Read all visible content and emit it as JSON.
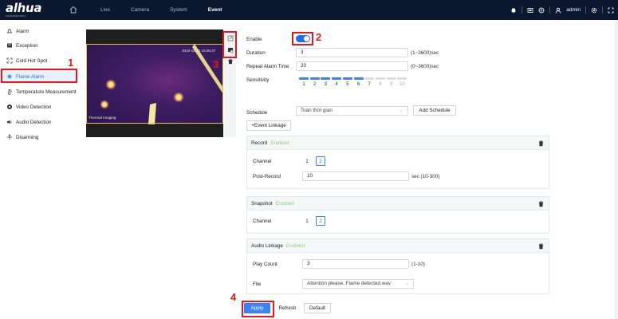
{
  "brand": {
    "logo": "alhua",
    "subtext": "TECHNOLOGY"
  },
  "nav": [
    {
      "label": "Live"
    },
    {
      "label": "Camera"
    },
    {
      "label": "System"
    },
    {
      "label": "Event",
      "active": true
    }
  ],
  "topright": {
    "user": "admin"
  },
  "sidebar": {
    "items": [
      {
        "label": "Alarm",
        "icon": "alarm-icon"
      },
      {
        "label": "Exception",
        "icon": "exception-icon"
      },
      {
        "label": "Cold Hot Spot",
        "icon": "cold-hot-spot-icon"
      },
      {
        "label": "Flame Alarm",
        "icon": "flame-icon",
        "active": true
      },
      {
        "label": "Temperature Measurement",
        "icon": "thermometer-icon"
      },
      {
        "label": "Video Detection",
        "icon": "video-detection-icon"
      },
      {
        "label": "Audio Detection",
        "icon": "audio-icon"
      },
      {
        "label": "Disarming",
        "icon": "disarming-icon"
      }
    ]
  },
  "video": {
    "timestamp": "2023-11-30 15:05:27",
    "label": "Thermal Imaging"
  },
  "form": {
    "enable_label": "Enable",
    "duration_label": "Duration",
    "duration_value": "3",
    "duration_hint": "(1~3600)sec",
    "repeat_label": "Repeat Alarm Time",
    "repeat_value": "20",
    "repeat_hint": "(0~3600)sec",
    "sensitivity_label": "Sensitivity",
    "sensitivity_level": 6,
    "sensitivity_ticks": [
      "1",
      "2",
      "3",
      "4",
      "5",
      "6",
      "7",
      "8",
      "9",
      "10"
    ],
    "schedule_label": "Schedule",
    "schedule_value": "Toàn thời gian",
    "add_schedule": "Add Schedule",
    "event_linkage": "+Event Linkage"
  },
  "record": {
    "title": "Record",
    "status": "Enabled",
    "channel_label": "Channel",
    "channels": [
      "1",
      "2"
    ],
    "post_label": "Post-Record",
    "post_value": "10",
    "post_hint": "sec (10-300)"
  },
  "snapshot": {
    "title": "Snapshot",
    "status": "Enabled",
    "channel_label": "Channel",
    "channels": [
      "1",
      "2"
    ]
  },
  "audio": {
    "title": "Audio Linkage",
    "status": "Enabled",
    "play_label": "Play Count",
    "play_value": "3",
    "play_hint": "(1-10)",
    "file_label": "File",
    "file_value": "Attention please, Flame detected.wav"
  },
  "buttons": {
    "apply": "Apply",
    "refresh": "Refresh",
    "default": "Default"
  },
  "annotations": [
    "1",
    "2",
    "3",
    "4"
  ],
  "colors": {
    "accent": "#1d6ee8",
    "annotation": "#e8191c",
    "enabled": "#8fd27e",
    "topbar": "#0c1830"
  }
}
